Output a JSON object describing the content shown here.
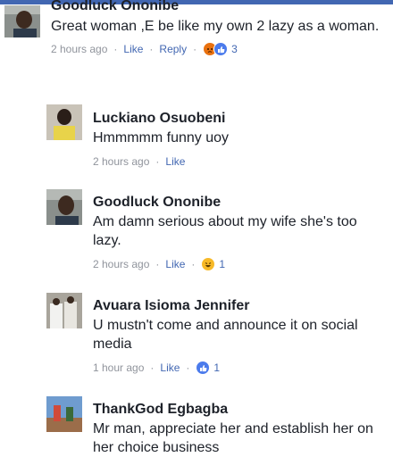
{
  "comments": [
    {
      "author": "Goodluck Ononibe",
      "text": "Great woman ,E be like my own 2 lazy as a woman.",
      "time": "2 hours ago",
      "like": "Like",
      "reply": "Reply",
      "reactions": [
        "angry",
        "like"
      ],
      "reaction_count": "3"
    },
    {
      "author": "Luckiano Osuobeni",
      "text": "Hmmmmm funny uoy",
      "time": "2 hours ago",
      "like": "Like"
    },
    {
      "author": "Goodluck Ononibe",
      "text": "Am damn serious about my wife she's too lazy.",
      "time": "2 hours ago",
      "like": "Like",
      "reactions": [
        "haha"
      ],
      "reaction_count": "1"
    },
    {
      "author": "Avuara Isioma Jennifer",
      "text": "U mustn't come and announce it on social media",
      "time": "1 hour ago",
      "like": "Like",
      "reactions": [
        "like"
      ],
      "reaction_count": "1"
    },
    {
      "author": "ThankGod Egbagba",
      "text": "Mr man, appreciate her and establish her on her choice business"
    }
  ],
  "colors": {
    "link": "#4267b2",
    "meta": "#90949c",
    "text": "#1d2129",
    "angry": "#e9710f",
    "like": "#4b7bec",
    "haha": "#f7b928"
  }
}
